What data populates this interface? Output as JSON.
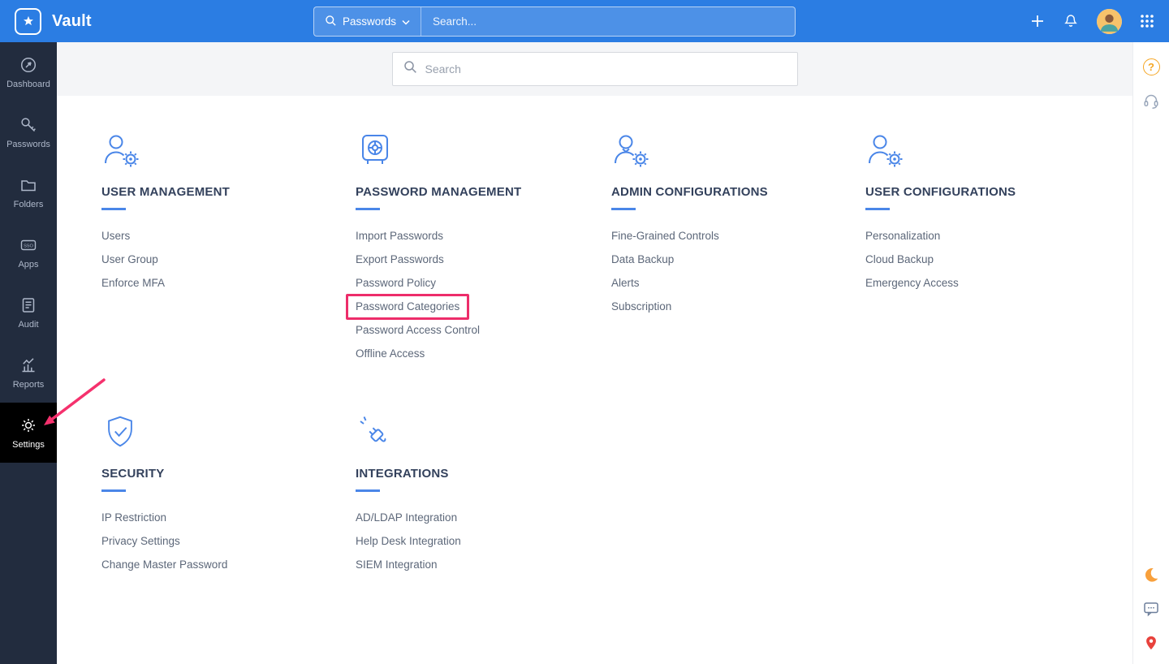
{
  "topbar": {
    "app_name": "Vault",
    "search_scope": "Passwords",
    "search_placeholder": "Search..."
  },
  "sidebar": {
    "sso_icon_text": "SSO",
    "active_item": "Settings",
    "items": [
      {
        "label": "Dashboard"
      },
      {
        "label": "Passwords"
      },
      {
        "label": "Folders"
      },
      {
        "label": "Apps"
      },
      {
        "label": "Audit"
      },
      {
        "label": "Reports"
      },
      {
        "label": "Settings"
      }
    ]
  },
  "main": {
    "search_placeholder": "Search",
    "sections": [
      {
        "title": "USER MANAGEMENT",
        "items": [
          "Users",
          "User Group",
          "Enforce MFA"
        ]
      },
      {
        "title": "PASSWORD MANAGEMENT",
        "items": [
          "Import Passwords",
          "Export Passwords",
          "Password Policy",
          "Password Categories",
          "Password Access Control",
          "Offline Access"
        ],
        "highlighted_item": "Password Categories"
      },
      {
        "title": "ADMIN CONFIGURATIONS",
        "items": [
          "Fine-Grained Controls",
          "Data Backup",
          "Alerts",
          "Subscription"
        ]
      },
      {
        "title": "USER CONFIGURATIONS",
        "items": [
          "Personalization",
          "Cloud Backup",
          "Emergency Access"
        ]
      },
      {
        "title": "SECURITY",
        "items": [
          "IP Restriction",
          "Privacy Settings",
          "Change Master Password"
        ]
      },
      {
        "title": "INTEGRATIONS",
        "items": [
          "AD/LDAP Integration",
          "Help Desk Integration",
          "SIEM Integration"
        ]
      }
    ]
  },
  "rightrail": {
    "help_glyph": "?"
  },
  "annotations": {
    "highlighted_link": "Password Categories",
    "arrow_target": "Settings",
    "highlight_color": "#ed2d6a"
  },
  "colors": {
    "topbar": "#2b7de3",
    "sidebar": "#222c3e",
    "sidebar_active": "#000000",
    "accent_blue": "#4a86e8"
  }
}
